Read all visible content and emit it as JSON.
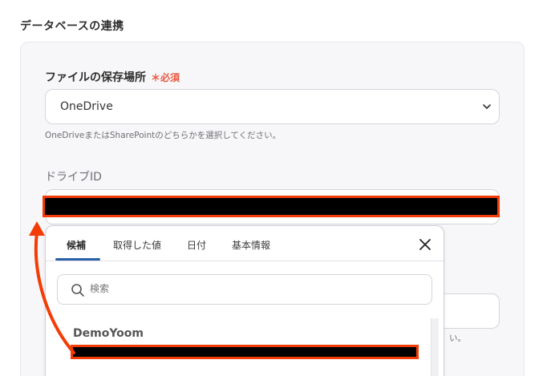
{
  "section": {
    "title": "データベースの連携"
  },
  "storage": {
    "label": "ファイルの保存場所",
    "required_mark": "＊必須",
    "selected": "OneDrive",
    "hint": "OneDriveまたはSharePointのどちらかを選択してください。"
  },
  "drive": {
    "label": "ドライブID"
  },
  "background_hint_tail": "い。",
  "popup": {
    "tabs": [
      {
        "label": "候補"
      },
      {
        "label": "取得した値"
      },
      {
        "label": "日付"
      },
      {
        "label": "基本情報"
      }
    ],
    "search_placeholder": "検索",
    "group_label": "DemoYoom"
  },
  "colors": {
    "accent": "#2b5fa8",
    "required": "#e8563f",
    "highlight": "#f33c06"
  }
}
